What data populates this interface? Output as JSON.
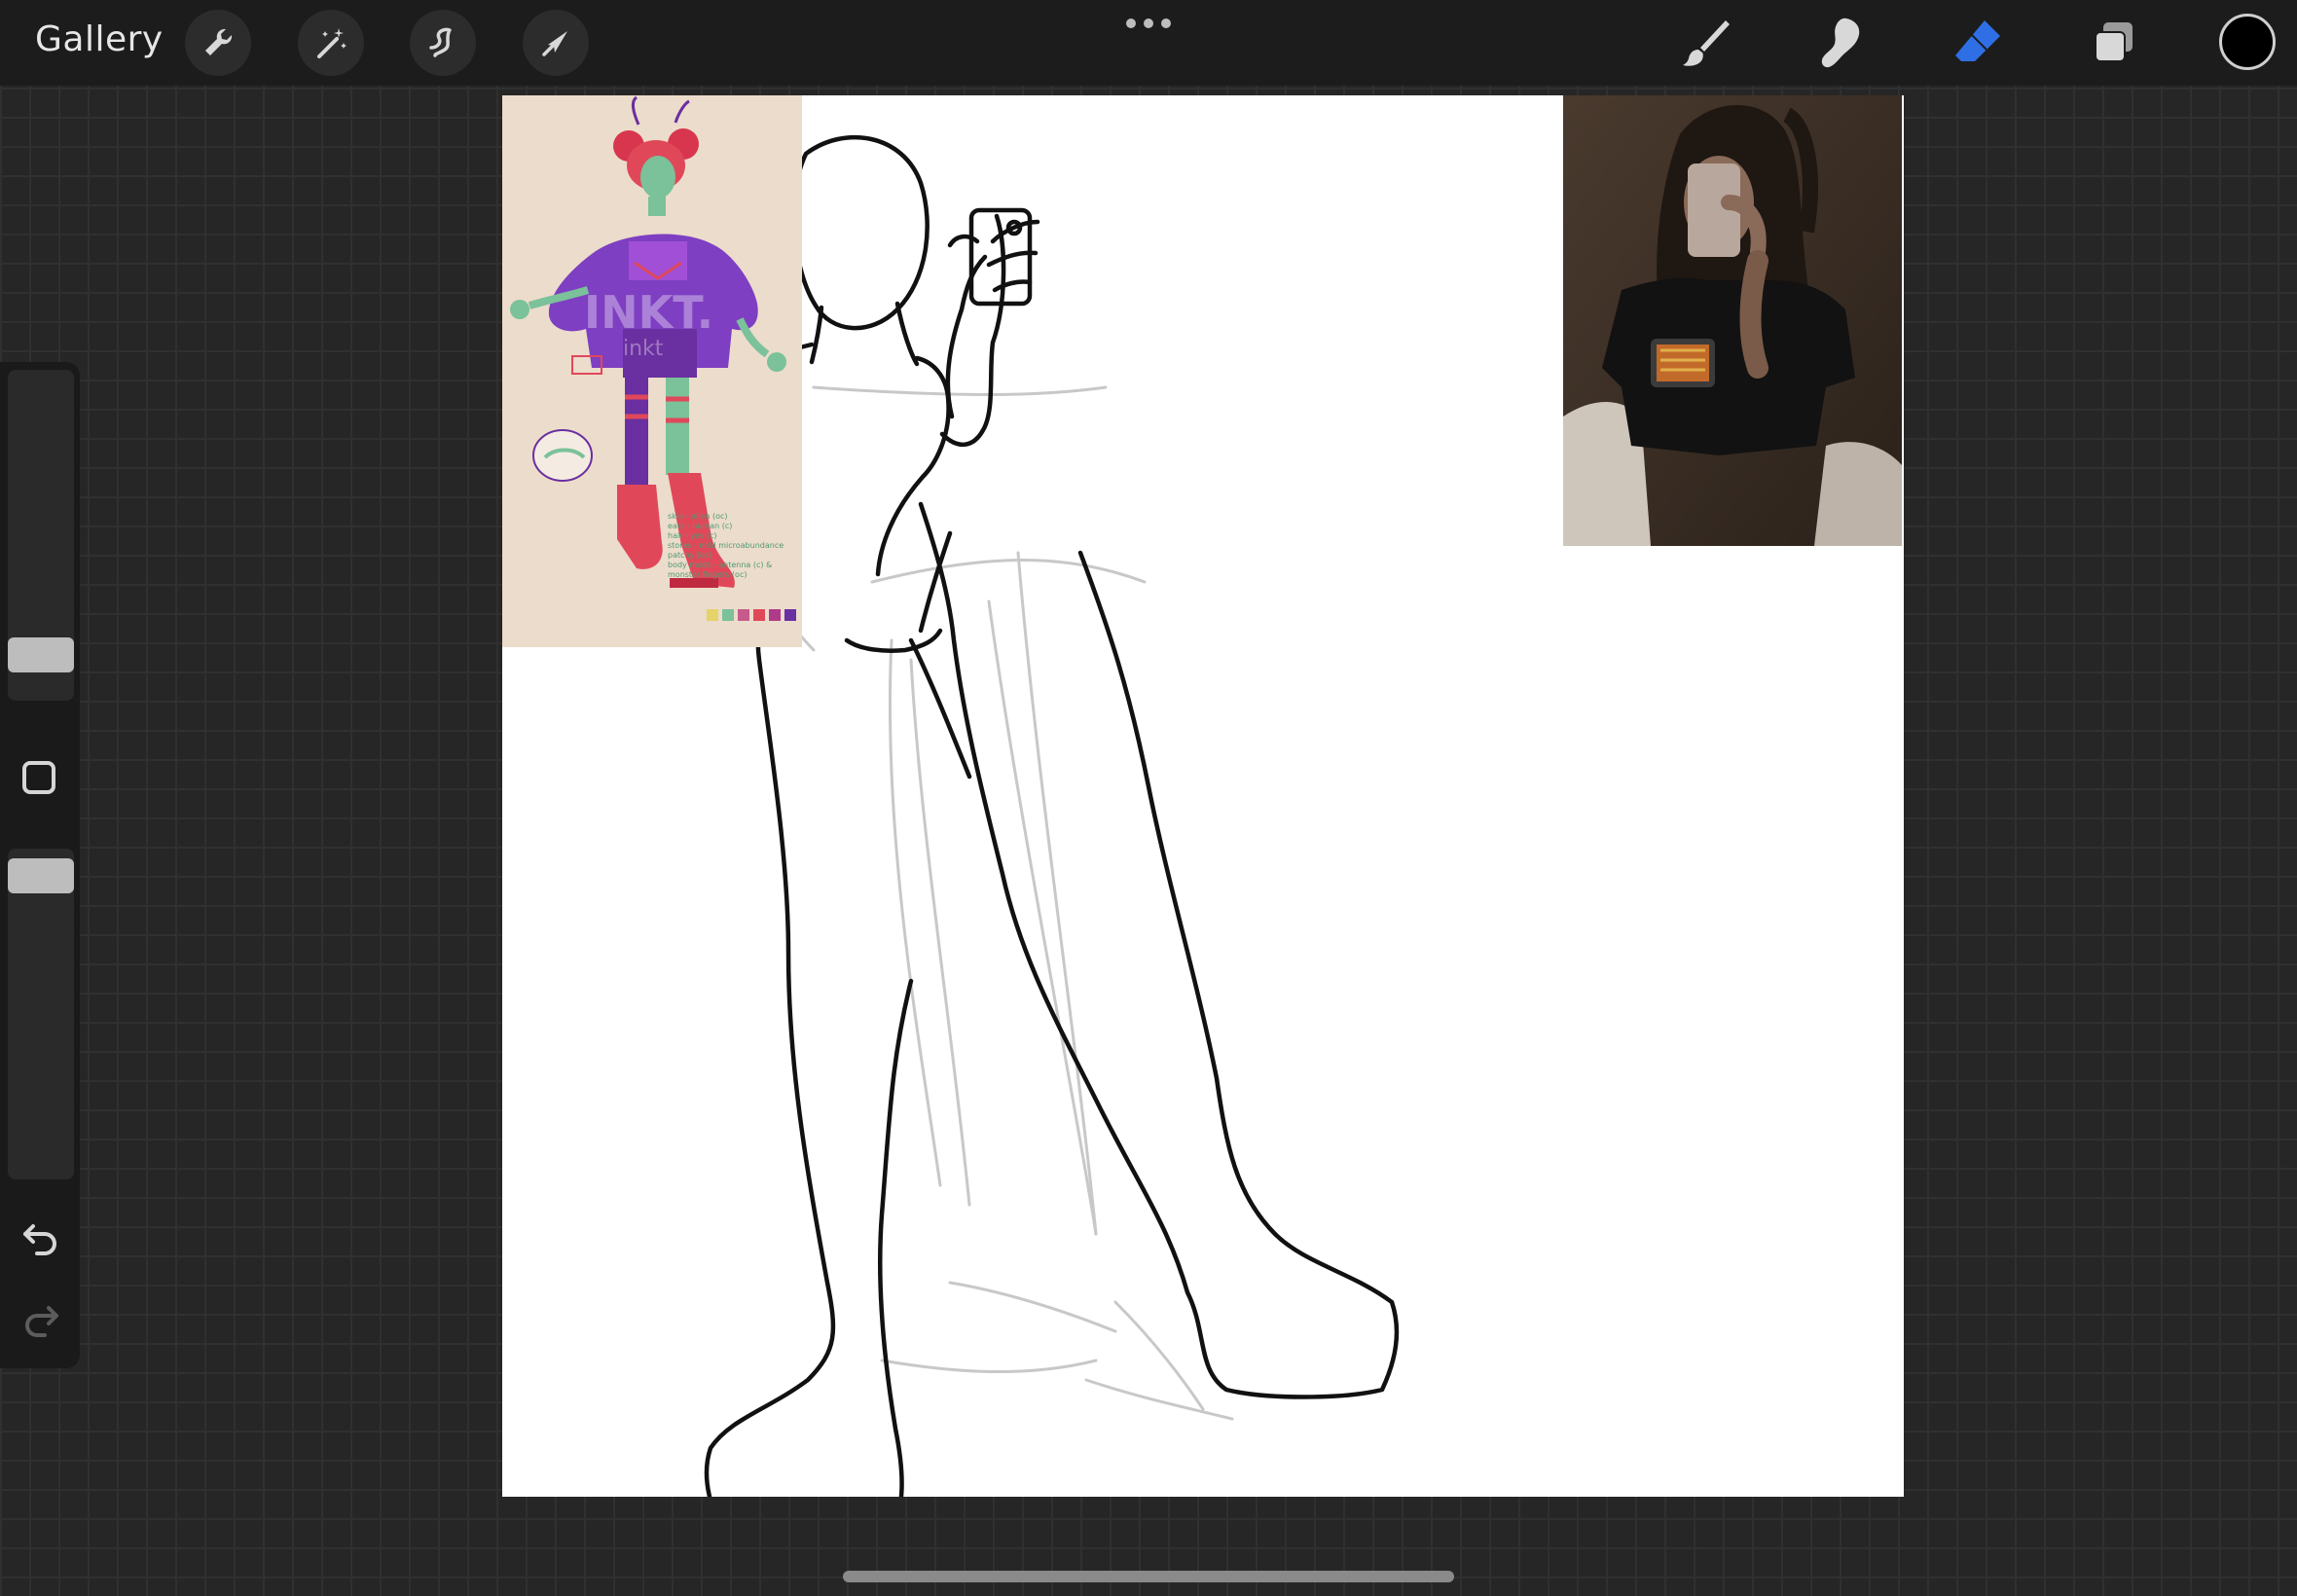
{
  "topbar": {
    "gallery_label": "Gallery",
    "left_tools": [
      "wrench-icon",
      "magic-wand-icon",
      "selection-icon",
      "transform-arrow-icon"
    ],
    "menu_icon": "ellipsis-icon",
    "right_tools": [
      "brush-icon",
      "smudge-icon",
      "eraser-icon",
      "layers-icon"
    ],
    "active_tool": "eraser",
    "active_color": "#000000",
    "accent_color": "#2f6fe6"
  },
  "sidebar": {
    "size_slider_level": 0.82,
    "opacity_slider_level": 0.0,
    "modifier_icon": "square-modifier-icon",
    "undo_icon": "undo-icon",
    "redo_icon": "redo-icon"
  },
  "reference_left": {
    "watermark": "INKT.",
    "watermark_small": "inkt",
    "notes": [
      "skin - alien (oc)",
      "ears - human (c)",
      "hair - yes (c)",
      "stores - mild microabundance",
      "patchy (oc)",
      "body mods - antenna (c) &",
      "monster fingers (oc)"
    ],
    "palette": [
      "#e6d36a",
      "#7bc19a",
      "#c65a8c",
      "#e0485a",
      "#b03a8a",
      "#6a2fa0"
    ]
  }
}
